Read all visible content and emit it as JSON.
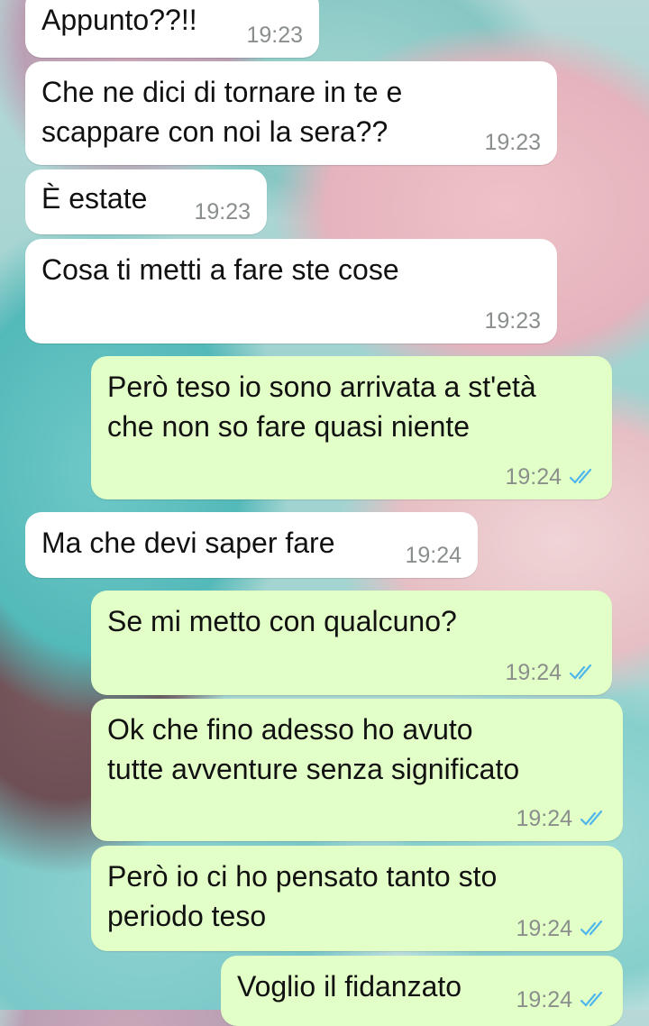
{
  "messages": [
    {
      "direction": "in",
      "text": "Appunto??!!",
      "time": "19:23"
    },
    {
      "direction": "in",
      "text": "Che ne dici di tornare in te e\nscappare con noi la sera??",
      "time": "19:23"
    },
    {
      "direction": "in",
      "text": "È estate",
      "time": "19:23"
    },
    {
      "direction": "in",
      "text": "Cosa ti metti a fare ste cose",
      "time": "19:23"
    },
    {
      "direction": "out",
      "text": "Però teso io sono arrivata a st'età\nche non so fare quasi niente",
      "time": "19:24",
      "status": "read"
    },
    {
      "direction": "in",
      "text": "Ma che devi saper fare",
      "time": "19:24"
    },
    {
      "direction": "out",
      "text": "Se mi metto con qualcuno?",
      "time": "19:24",
      "status": "read"
    },
    {
      "direction": "out",
      "text": "Ok che fino adesso ho avuto\ntutte avventure senza significato",
      "time": "19:24",
      "status": "read"
    },
    {
      "direction": "out",
      "text": "Però io ci ho pensato tanto sto\nperiodo teso",
      "time": "19:24",
      "status": "read"
    },
    {
      "direction": "out",
      "text": "Voglio il fidanzato",
      "time": "19:24",
      "status": "read"
    }
  ],
  "colors": {
    "incoming_bubble": "#ffffff",
    "outgoing_bubble": "#e2ffc7",
    "read_ticks": "#4fb6ec",
    "timestamp": "#8a8f8c"
  }
}
